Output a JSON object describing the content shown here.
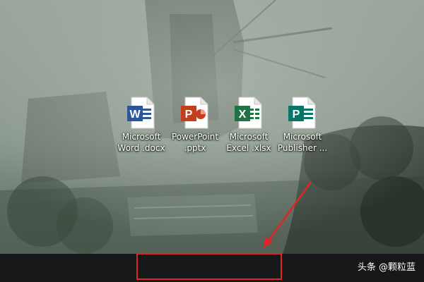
{
  "desktop": {
    "icons": [
      {
        "name": "word",
        "icon": "word-icon",
        "label": "Microsoft\nWord .docx",
        "letter": "W",
        "color": "#2b579a"
      },
      {
        "name": "powerpoint",
        "icon": "powerpoint-icon",
        "label": "PowerPoint\n.pptx",
        "letter": "P",
        "color": "#c43e1c"
      },
      {
        "name": "excel",
        "icon": "excel-icon",
        "label": "Microsoft\nExcel .xlsx",
        "letter": "X",
        "color": "#217346"
      },
      {
        "name": "publisher",
        "icon": "publisher-icon",
        "label": "Microsoft\nPublisher ...",
        "letter": "P",
        "color": "#077568"
      }
    ]
  },
  "taskbar": {
    "color": "#161718"
  },
  "annotation": {
    "highlight_color": "#e02525",
    "arrow_color": "#e02525"
  },
  "watermark": {
    "text": "头条 @颗粒蓝"
  }
}
